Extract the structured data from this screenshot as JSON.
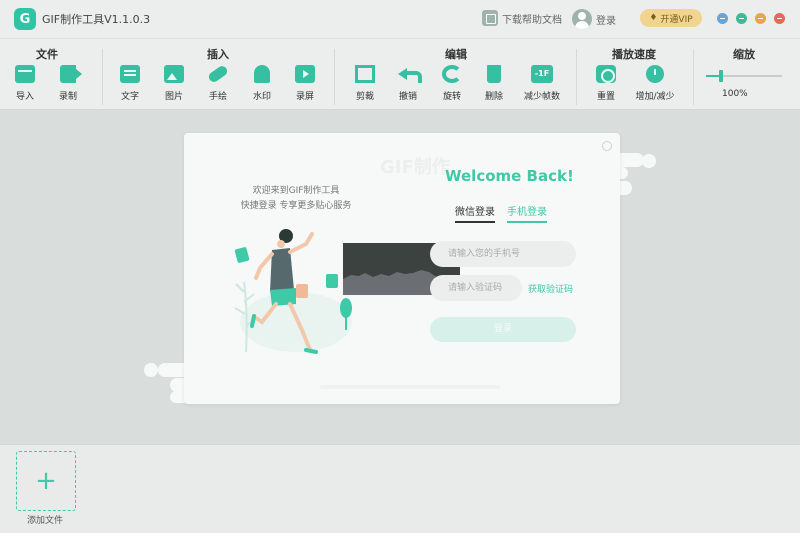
{
  "titlebar": {
    "logo_letter": "G",
    "title": "GIF制作工具V1.1.0.3",
    "help_label": "下载帮助文档",
    "login_label": "登录",
    "vip_label": "开通VIP"
  },
  "toolbar": {
    "groups": [
      {
        "title": "文件",
        "tools": [
          {
            "label": "导入",
            "icon": "import-icon"
          },
          {
            "label": "录制",
            "icon": "camera-icon"
          }
        ]
      },
      {
        "title": "插入",
        "tools": [
          {
            "label": "文字",
            "icon": "text-icon"
          },
          {
            "label": "图片",
            "icon": "image-icon"
          },
          {
            "label": "手绘",
            "icon": "pen-icon"
          },
          {
            "label": "水印",
            "icon": "stamp-icon"
          },
          {
            "label": "录屏",
            "icon": "screen-record-icon"
          }
        ]
      },
      {
        "title": "编辑",
        "tools": [
          {
            "label": "剪裁",
            "icon": "crop-icon"
          },
          {
            "label": "撤销",
            "icon": "undo-icon"
          },
          {
            "label": "旋转",
            "icon": "rotate-icon"
          },
          {
            "label": "删除",
            "icon": "trash-icon"
          },
          {
            "label": "减少帧数",
            "icon": "reduce-frames-icon",
            "icon_text": "-1F"
          }
        ]
      },
      {
        "title": "播放速度",
        "tools": [
          {
            "label": "重置",
            "icon": "reset-icon"
          },
          {
            "label": "增加/减少",
            "icon": "speed-icon"
          }
        ]
      },
      {
        "title": "缩放",
        "zoom_value": "100%",
        "zoom_fraction": 0.2
      }
    ]
  },
  "dialog": {
    "welcome_left_line1": "欢迎来到GIF制作工具",
    "welcome_left_line2": "快捷登录 专享更多贴心服务",
    "welcome_title": "Welcome Back!",
    "tab_wechat": "微信登录",
    "tab_phone": "手机登录",
    "phone_placeholder": "请输入您的手机号",
    "code_placeholder": "请输入验证码",
    "get_code_label": "获取验证码",
    "submit_label": "登录",
    "ghost_title": "GIF制作"
  },
  "bottom": {
    "add_label": "添加文件",
    "add_symbol": "+"
  },
  "colors": {
    "accent": "#36bfa1",
    "accent_text": "#3ec9a7",
    "vip": "#f1d48f"
  }
}
